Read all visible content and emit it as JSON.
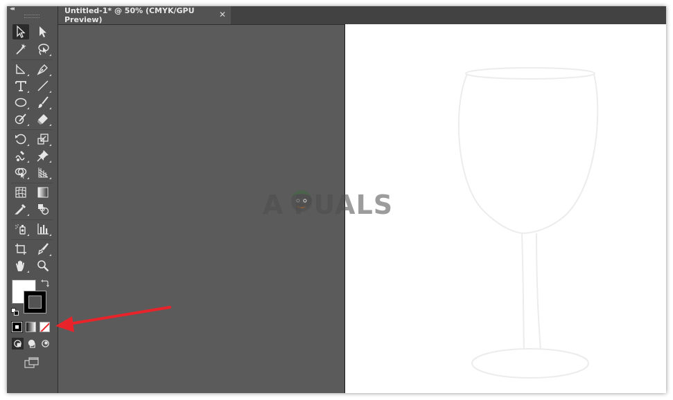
{
  "tab": {
    "title": "Untitled-1* @ 50% (CMYK/GPU Preview)",
    "close_glyph": "✕"
  },
  "toolbar": {
    "collapse_glyph": "◂◂",
    "tools": [
      "selection-tool",
      "direct-selection-tool",
      "magic-wand-tool",
      "lasso-tool",
      "anchor-point-tool",
      "pen-tool",
      "type-tool",
      "line-segment-tool",
      "ellipse-tool",
      "paintbrush-tool",
      "shaper-tool",
      "eraser-tool",
      "rotate-tool",
      "scale-tool",
      "warp-tool",
      "puppet-warp-tool",
      "shape-builder-tool",
      "perspective-grid-tool",
      "mesh-tool",
      "gradient-tool",
      "eyedropper-tool",
      "blend-tool",
      "symbol-sprayer-tool",
      "column-graph-tool",
      "artboard-tool",
      "slice-tool",
      "hand-tool",
      "zoom-tool"
    ],
    "fill_color": "#ffffff",
    "stroke_color": "#000000",
    "color_modes": [
      "color",
      "gradient",
      "none"
    ],
    "selected_color_mode": "none"
  },
  "canvas": {
    "pasteboard_color": "#5b5b5b",
    "artboard_color": "#ffffff"
  },
  "watermark": {
    "text": "A  PUALS"
  },
  "annotation": {
    "arrow_color": "#e8242a",
    "points_to": "none-color-mode-button"
  }
}
